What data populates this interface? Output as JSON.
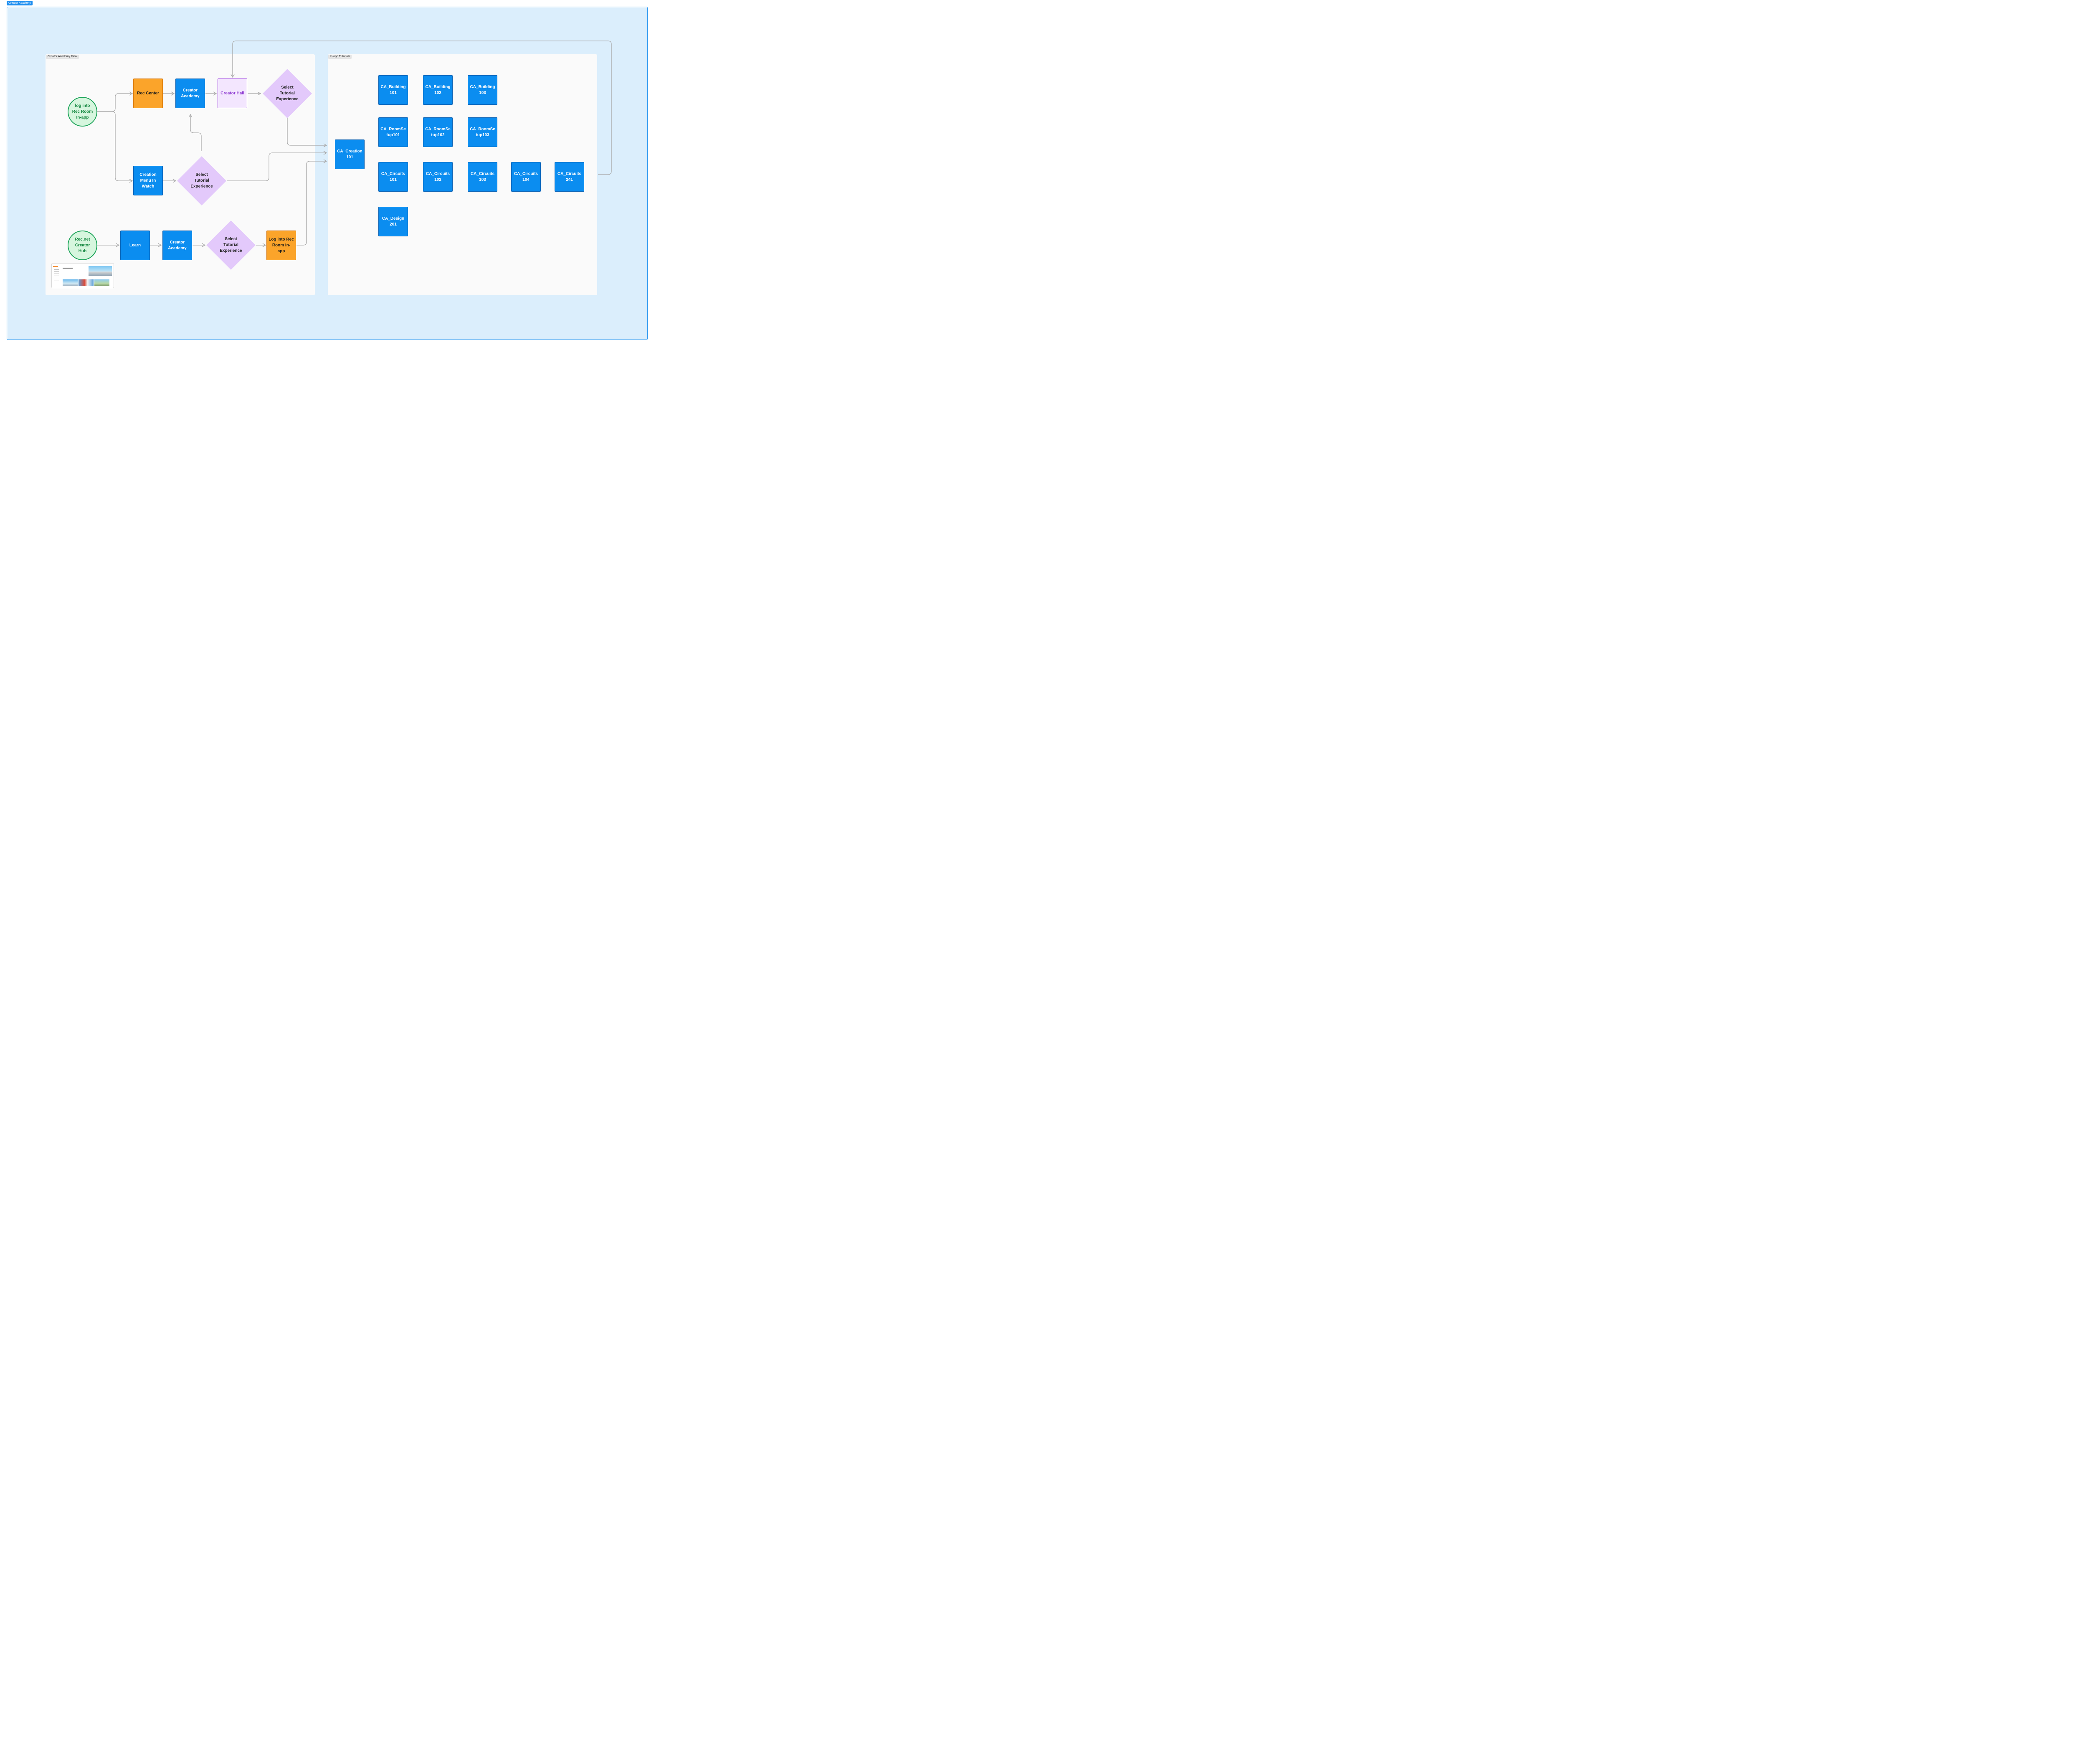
{
  "section": {
    "label": "Creator Academy"
  },
  "panels": {
    "flow": {
      "label": "Creator Academy Flow"
    },
    "tutorials": {
      "label": "In-app Tutorials"
    }
  },
  "flow_nodes": {
    "login_app": "log into\nRec Room\nIn-app",
    "rec_center": "Rec Center",
    "creator_academy_1": "Creator\nAcademy",
    "creator_hall": "Creator Hall",
    "select_1": "Select\nTutorial\nExperience",
    "creation_menu": "Creation\nMenu In\nWatch",
    "select_2": "Select\nTutorial\nExperience",
    "recnet_hub": "Rec.net\nCreator\nHub",
    "learn": "Learn",
    "creator_academy_2": "Creator\nAcademy",
    "select_3": "Select\nTutorial\nExperience",
    "login_rec_room": "Log into Rec\nRoom in-\napp"
  },
  "tutorials": {
    "creation_101": "CA_Creation\n101",
    "building_101": "CA_Building\n101",
    "building_102": "CA_Building\n102",
    "building_103": "CA_Building\n103",
    "roomsetup_101": "CA_RoomSe\ntup101",
    "roomsetup_102": "CA_RoomSe\ntup102",
    "roomsetup_103": "CA_RoomSe\ntup103",
    "circuits_101": "CA_Circuits\n101",
    "circuits_102": "CA_Circuits\n102",
    "circuits_103": "CA_Circuits\n103",
    "circuits_104": "CA_Circuits\n104",
    "circuits_241": "CA_Circuits\n241",
    "design_201": "CA_Design\n201"
  },
  "colors": {
    "process": "#0b8df0",
    "highlight": "#fba42a",
    "target": "#f3e6fe",
    "decision": "#e3c9fb",
    "start": "#d6f6de",
    "section_bg": "#dbeefc",
    "connector": "#a9a9a9"
  }
}
